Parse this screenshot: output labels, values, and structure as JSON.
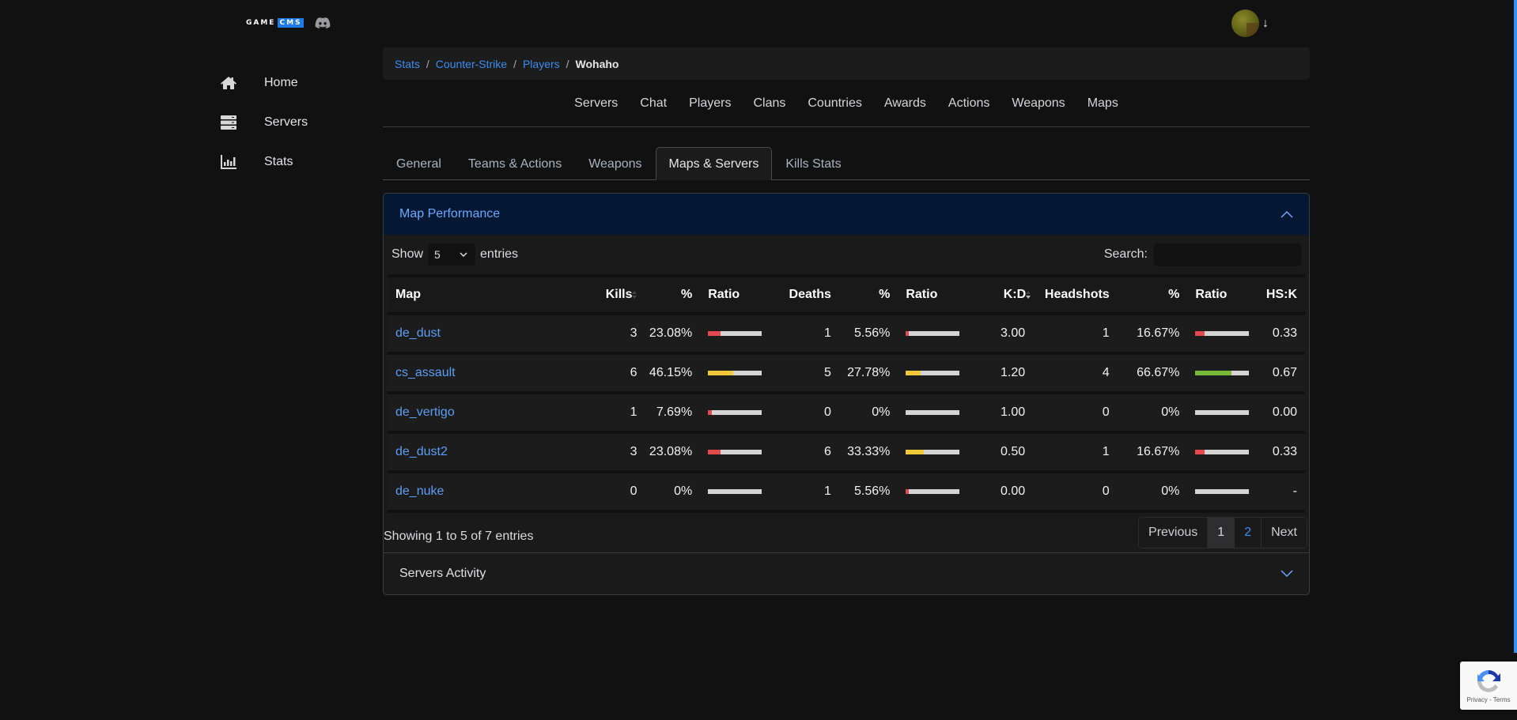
{
  "logo": {
    "text_left": "GAME",
    "text_right": "CMS"
  },
  "user": {
    "avatar_alt": "user-avatar"
  },
  "sidebar": {
    "items": [
      {
        "label": "Home",
        "icon": "home-icon"
      },
      {
        "label": "Servers",
        "icon": "servers-icon"
      },
      {
        "label": "Stats",
        "icon": "stats-icon"
      }
    ]
  },
  "breadcrumb": {
    "items": [
      "Stats",
      "Counter-Strike",
      "Players"
    ],
    "current": "Wohaho",
    "separator": "/"
  },
  "topnav": {
    "items": [
      "Servers",
      "Chat",
      "Players",
      "Clans",
      "Countries",
      "Awards",
      "Actions",
      "Weapons",
      "Maps"
    ]
  },
  "tabs": {
    "items": [
      "General",
      "Teams & Actions",
      "Weapons",
      "Maps & Servers",
      "Kills Stats"
    ],
    "active": "Maps & Servers"
  },
  "map_performance": {
    "title": "Map Performance",
    "show_label": "Show",
    "entries_label": "entries",
    "page_size": "5",
    "search_label": "Search:",
    "search_value": "",
    "columns": [
      "Map",
      "Kills",
      "%",
      "Ratio",
      "Deaths",
      "%",
      "Ratio",
      "K:D",
      "Headshots",
      "%",
      "Ratio",
      "HS:K"
    ],
    "rows": [
      {
        "map": "de_dust",
        "kills": "3",
        "kills_pct": "23.08%",
        "kills_ratio": 0.2308,
        "kills_color": "red",
        "deaths": "1",
        "deaths_pct": "5.56%",
        "deaths_ratio": 0.0556,
        "deaths_color": "red",
        "kd": "3.00",
        "headshots": "1",
        "hs_pct": "16.67%",
        "hs_ratio": 0.1667,
        "hs_color": "red",
        "hsk": "0.33"
      },
      {
        "map": "cs_assault",
        "kills": "6",
        "kills_pct": "46.15%",
        "kills_ratio": 0.4615,
        "kills_color": "yellow",
        "deaths": "5",
        "deaths_pct": "27.78%",
        "deaths_ratio": 0.2778,
        "deaths_color": "yellow",
        "kd": "1.20",
        "headshots": "4",
        "hs_pct": "66.67%",
        "hs_ratio": 0.6667,
        "hs_color": "green",
        "hsk": "0.67"
      },
      {
        "map": "de_vertigo",
        "kills": "1",
        "kills_pct": "7.69%",
        "kills_ratio": 0.0769,
        "kills_color": "red",
        "deaths": "0",
        "deaths_pct": "0%",
        "deaths_ratio": 0,
        "deaths_color": "red",
        "kd": "1.00",
        "headshots": "0",
        "hs_pct": "0%",
        "hs_ratio": 0,
        "hs_color": "red",
        "hsk": "0.00"
      },
      {
        "map": "de_dust2",
        "kills": "3",
        "kills_pct": "23.08%",
        "kills_ratio": 0.2308,
        "kills_color": "red",
        "deaths": "6",
        "deaths_pct": "33.33%",
        "deaths_ratio": 0.3333,
        "deaths_color": "yellow",
        "kd": "0.50",
        "headshots": "1",
        "hs_pct": "16.67%",
        "hs_ratio": 0.1667,
        "hs_color": "red",
        "hsk": "0.33"
      },
      {
        "map": "de_nuke",
        "kills": "0",
        "kills_pct": "0%",
        "kills_ratio": 0,
        "kills_color": "red",
        "deaths": "1",
        "deaths_pct": "5.56%",
        "deaths_ratio": 0.0556,
        "deaths_color": "red",
        "kd": "0.00",
        "headshots": "0",
        "hs_pct": "0%",
        "hs_ratio": 0,
        "hs_color": "red",
        "hsk": "-"
      }
    ],
    "info": "Showing 1 to 5 of 7 entries",
    "pagination": {
      "previous": "Previous",
      "pages": [
        "1",
        "2"
      ],
      "current": "1",
      "next": "Next"
    }
  },
  "servers_activity": {
    "title": "Servers Activity"
  },
  "recaptcha": {
    "text": "Privacy - Terms"
  },
  "colors": {
    "accent": "#3b8df0",
    "bar_red": "#e5484d",
    "bar_yellow": "#f0c93a",
    "bar_green": "#79b83a",
    "bar_track": "#d4d4d4",
    "header_bg": "#041833"
  }
}
